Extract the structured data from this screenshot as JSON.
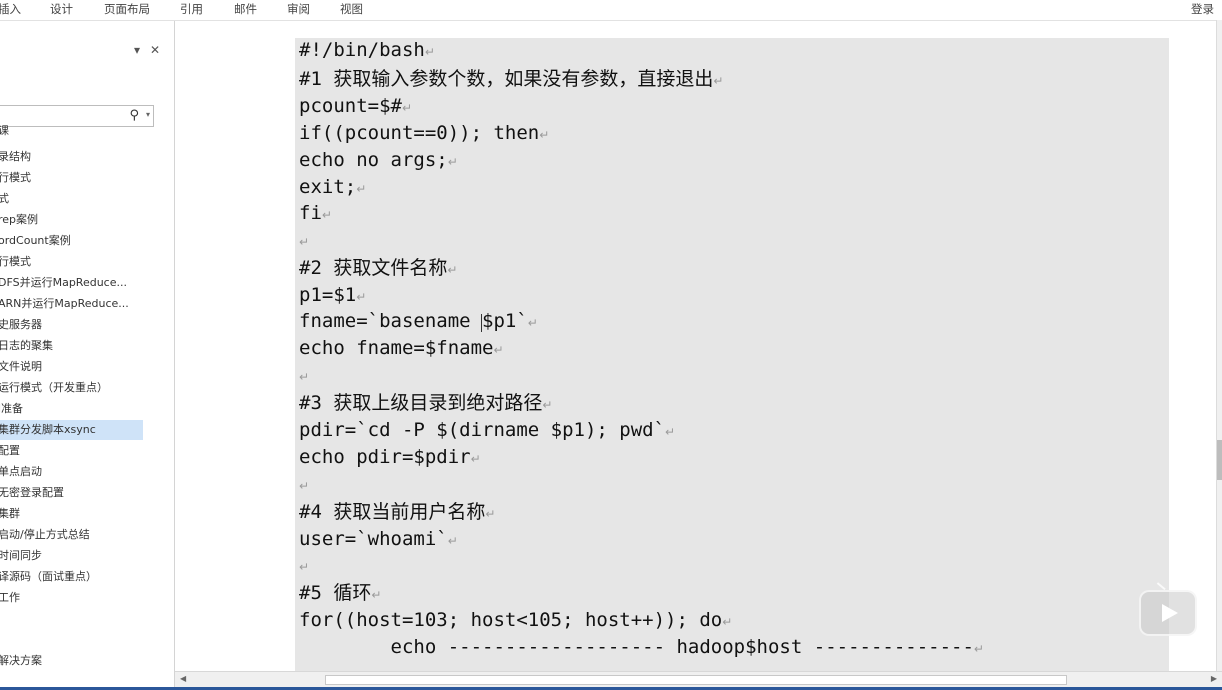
{
  "ribbon": {
    "tabs": [
      "插入",
      "设计",
      "页面布局",
      "引用",
      "邮件",
      "审阅",
      "视图"
    ],
    "login": "登录"
  },
  "nav": {
    "dropdown_glyph": "▾",
    "close_glyph": "✕",
    "items": [
      "课",
      "录结构",
      "行模式",
      "式",
      "rep案例",
      "ordCount案例",
      "行模式",
      "DFS并运行MapReduce...",
      "ARN并运行MapReduce...",
      "史服务器",
      "日志的聚集",
      "文件说明",
      "运行模式（开发重点）",
      "l准备",
      "集群分发脚本xsync",
      "配置",
      "单点启动",
      "无密登录配置",
      "集群",
      "启动/停止方式总结",
      "时间同步",
      "译源码（面试重点）",
      "工作",
      "解决方案"
    ],
    "selected_index": 14
  },
  "document": {
    "lines": [
      "#!/bin/bash",
      "#1 获取输入参数个数，如果没有参数，直接退出",
      "pcount=$#",
      "if((pcount==0)); then",
      "echo no args;",
      "exit;",
      "fi",
      "",
      "#2 获取文件名称",
      "p1=$1",
      "fname=`basename $p1`",
      "echo fname=$fname",
      "",
      "#3 获取上级目录到绝对路径",
      "pdir=`cd -P $(dirname $p1); pwd`",
      "echo pdir=$pdir",
      "",
      "#4 获取当前用户名称",
      "user=`whoami`",
      "",
      "#5 循环",
      "for((host=103; host<105; host++)); do",
      "        echo ------------------- hadoop$host --------------"
    ],
    "paragraph_mark": "↵"
  },
  "colors": {
    "code_bg": "#e6e6e6",
    "selected_nav_bg": "#cfe3f8",
    "status_bar": "#2b579a"
  }
}
